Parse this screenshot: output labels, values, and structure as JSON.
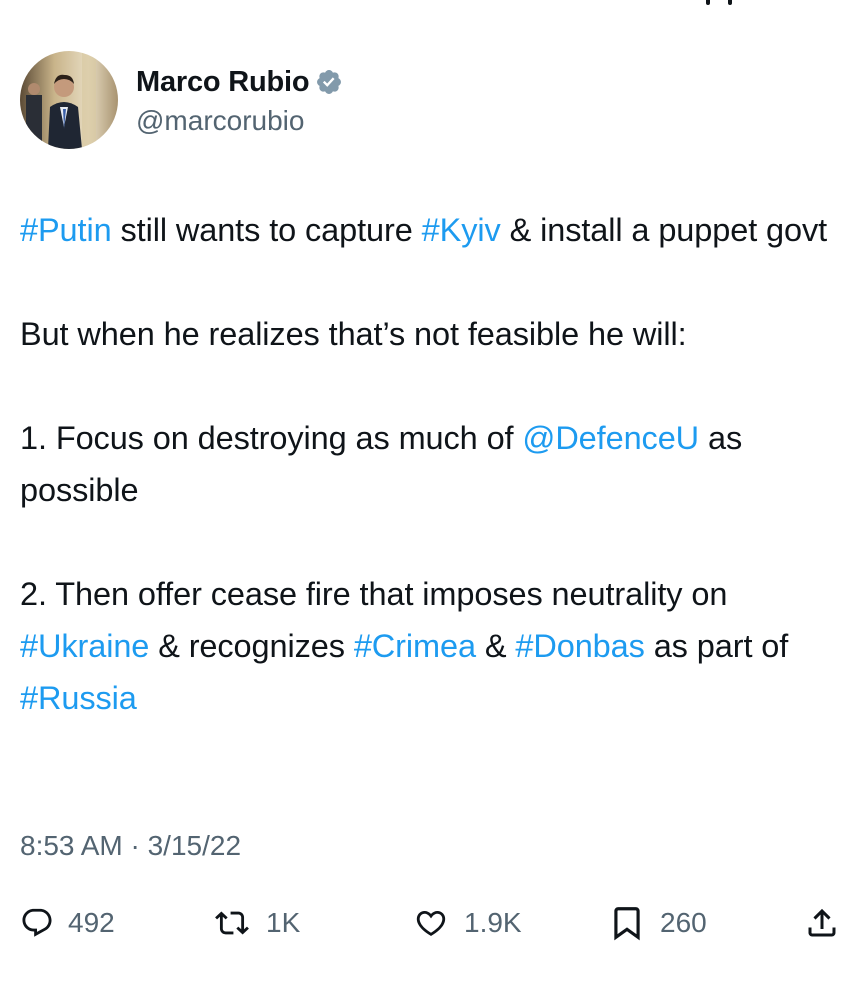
{
  "author": {
    "display_name": "Marco Rubio",
    "handle": "@marcorubio",
    "verified": true,
    "verified_badge_icon": "verified-badge-icon"
  },
  "tweet": {
    "paragraphs": [
      [
        {
          "text": "#Putin",
          "link": true
        },
        {
          "text": " still wants to capture ",
          "link": false
        },
        {
          "text": "#Kyiv",
          "link": true
        },
        {
          "text": " & install a puppet govt",
          "link": false
        }
      ],
      [
        {
          "text": "But when he realizes that’s not feasible he will:",
          "link": false
        }
      ],
      [
        {
          "text": "1. Focus on destroying as much of ",
          "link": false
        },
        {
          "text": "@DefenceU",
          "link": true
        },
        {
          "text": " as possible",
          "link": false
        }
      ],
      [
        {
          "text": "2. Then offer cease fire that imposes neutrality on ",
          "link": false
        },
        {
          "text": "#Ukraine",
          "link": true
        },
        {
          "text": " & recognizes ",
          "link": false
        },
        {
          "text": "#Crimea",
          "link": true
        },
        {
          "text": " & ",
          "link": false
        },
        {
          "text": "#Donbas",
          "link": true
        },
        {
          "text": " as part of ",
          "link": false
        },
        {
          "text": "#Russia",
          "link": true
        }
      ]
    ],
    "timestamp": "8:53 AM · 3/15/22"
  },
  "actions": {
    "reply": {
      "icon": "reply-icon",
      "count": "492"
    },
    "retweet": {
      "icon": "retweet-icon",
      "count": "1K"
    },
    "like": {
      "icon": "heart-icon",
      "count": "1.9K"
    },
    "bookmark": {
      "icon": "bookmark-icon",
      "count": "260"
    },
    "share": {
      "icon": "share-icon"
    }
  },
  "colors": {
    "text": "#0f1419",
    "secondary": "#536471",
    "link": "#1d9bf0",
    "verified": "#829aab"
  }
}
